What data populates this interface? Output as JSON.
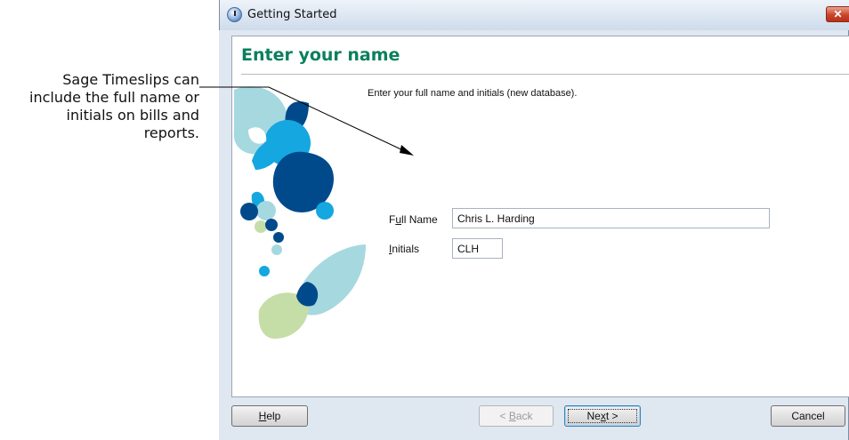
{
  "callout": {
    "lines": [
      "Sage Timeslips can",
      "include the full name or",
      "initials on bills and",
      "reports."
    ]
  },
  "window": {
    "title": "Getting Started",
    "close_glyph": "✕",
    "icon": "app-clock-icon"
  },
  "page": {
    "title": "Enter your name",
    "instruction": "Enter your full name and initials (new database).",
    "full_name": {
      "label_pre": "F",
      "label_accel": "u",
      "label_post": "ll Name",
      "value": "Chris L. Harding"
    },
    "initials": {
      "label_accel": "I",
      "label_post": "nitials",
      "value": "CLH"
    }
  },
  "buttons": {
    "help": {
      "accel": "H",
      "rest": "elp"
    },
    "back": {
      "prefix": "< ",
      "accel": "B",
      "rest": "ack"
    },
    "next": {
      "pre": "Ne",
      "accel": "x",
      "post": "t >"
    },
    "cancel": "Cancel"
  },
  "colors": {
    "title_green": "#0b7f5e",
    "dark_blue": "#004a8c",
    "cyan": "#15a7e0",
    "teal_light": "#a6d8df",
    "green_light": "#c5dea8"
  }
}
